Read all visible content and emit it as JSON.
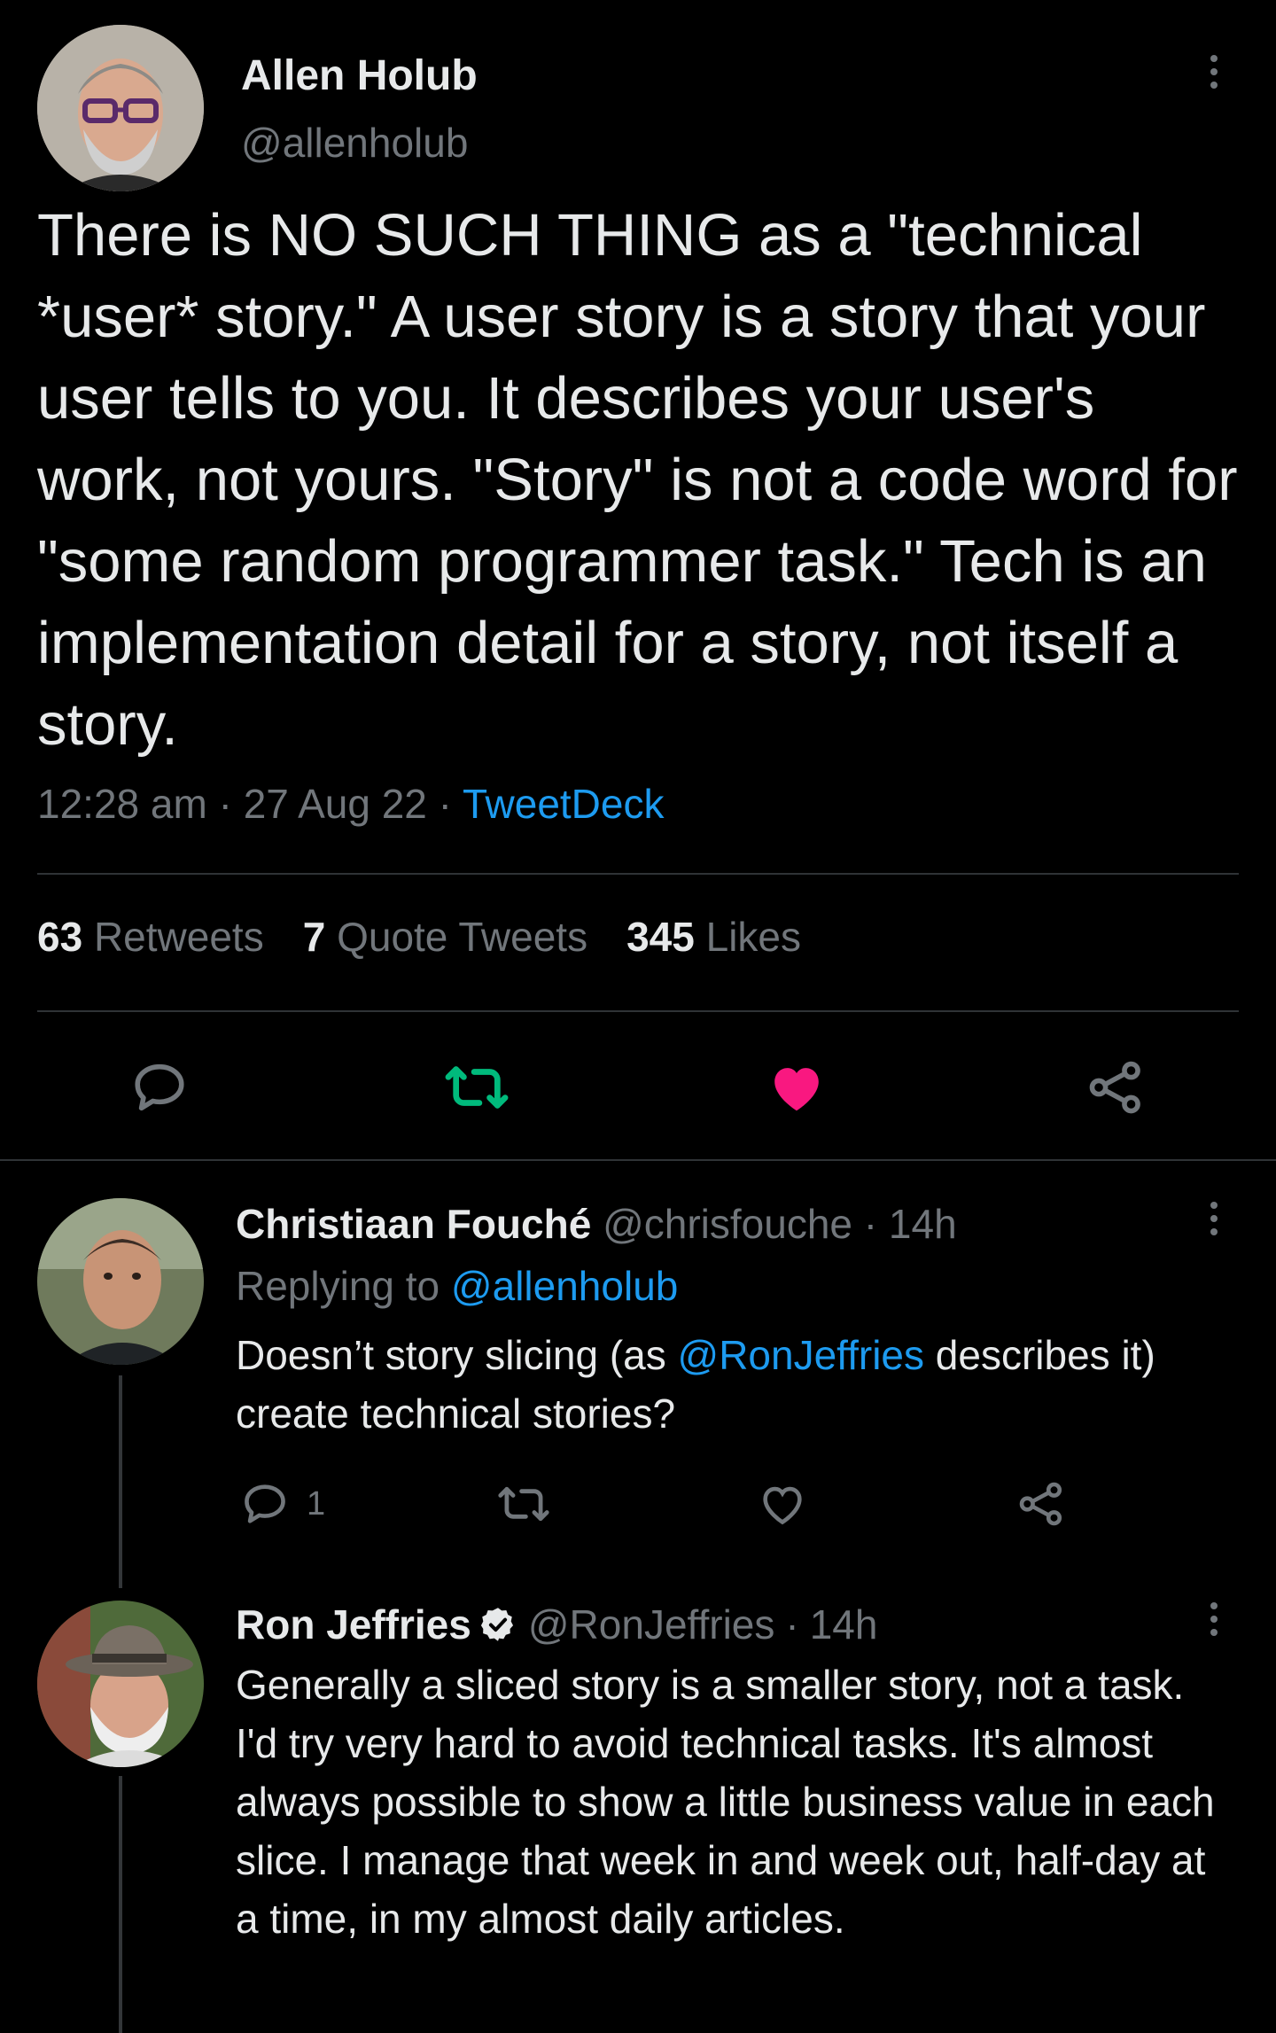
{
  "main_tweet": {
    "author_name": "Allen Holub",
    "handle": "@allenholub",
    "text": "There is NO SUCH THING as a \"technical *user* story.\" A user story is a story that your user tells to you. It describes your user's work, not yours. \"Story\" is not a code word for \"some random programmer task.\" Tech is an implementation detail for a story, not itself a story.",
    "time": "12:28 am",
    "date": "27 Aug 22",
    "source": "TweetDeck",
    "retweets_count": "63",
    "retweets_label": "Retweets",
    "quotes_count": "7",
    "quotes_label": "Quote Tweets",
    "likes_count": "345",
    "likes_label": "Likes",
    "liked": true
  },
  "replies": [
    {
      "author_name": "Christiaan Fouché",
      "handle": "@chrisfouche",
      "age": "14h",
      "replying_prefix": "Replying to",
      "replying_to": "@allenholub",
      "text_before": "Doesn’t story slicing (as ",
      "mention": "@RonJeffries",
      "text_after": " describes it) create technical stories?",
      "reply_count": "1"
    },
    {
      "author_name": "Ron Jeffries",
      "handle": "@RonJeffries",
      "age": "14h",
      "verified": true,
      "text": "Generally a sliced story is a smaller story, not a task. I'd try very hard to avoid technical tasks. It's almost always possible to show a little business value in each slice. I manage that week in and week out, half-day at a time, in my almost daily articles."
    }
  ],
  "separator": "·",
  "colors": {
    "background": "#000000",
    "text": "#e7e9ea",
    "muted": "#71767b",
    "link": "#1d9bf0",
    "like": "#f91880",
    "retweet": "#00ba7c",
    "verified": "#e7e9ea"
  },
  "icons": {
    "reply": "speech-bubble-icon",
    "retweet": "retweet-arrows-icon",
    "like": "heart-icon",
    "share": "share-nodes-icon",
    "more": "vertical-dots-icon",
    "verified": "verified-badge-icon"
  }
}
